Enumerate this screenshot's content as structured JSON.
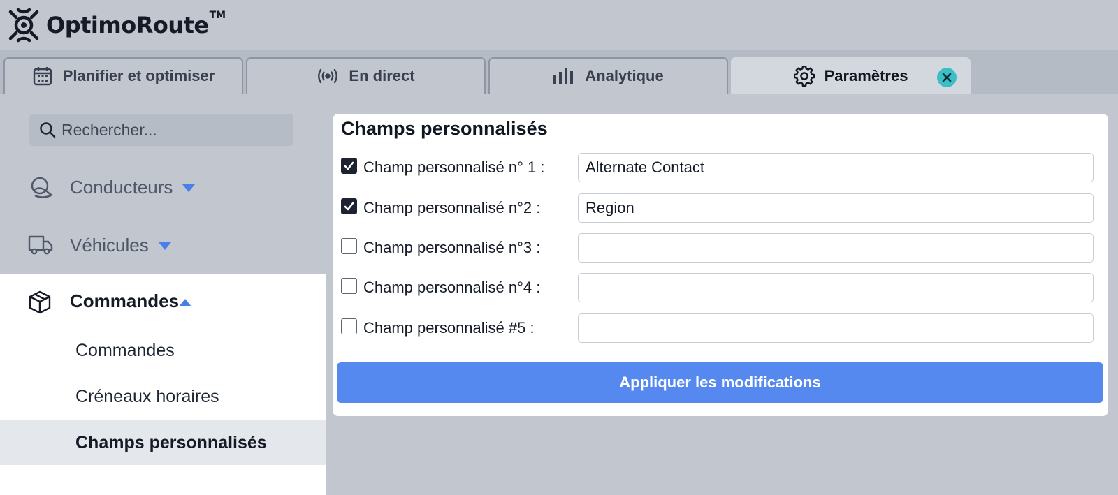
{
  "app": {
    "name": "OptimoRoute",
    "trademark": "TM"
  },
  "tabs": [
    {
      "label": "Planifier et optimiser",
      "icon": "calendar-icon",
      "active": false
    },
    {
      "label": "En direct",
      "icon": "broadcast-icon",
      "active": false
    },
    {
      "label": "Analytique",
      "icon": "bar-chart-icon",
      "active": false
    },
    {
      "label": "Paramètres",
      "icon": "gear-icon",
      "active": true
    }
  ],
  "sidebar": {
    "search_placeholder": "Rechercher...",
    "items": [
      {
        "label": "Conducteurs",
        "icon": "driver-icon",
        "expanded": false
      },
      {
        "label": "Véhicules",
        "icon": "truck-icon",
        "expanded": false
      },
      {
        "label": "Commandes",
        "icon": "package-icon",
        "expanded": true
      }
    ],
    "sub_items": [
      {
        "label": "Commandes",
        "selected": false
      },
      {
        "label": "Créneaux horaires",
        "selected": false
      },
      {
        "label": "Champs personnalisés",
        "selected": true
      }
    ]
  },
  "main": {
    "title": "Champs personnalisés",
    "fields": [
      {
        "label": "Champ personnalisé n° 1 :",
        "checked": true,
        "value": "Alternate Contact"
      },
      {
        "label": "Champ personnalisé n°2 :",
        "checked": true,
        "value": "Region"
      },
      {
        "label": "Champ personnalisé n°3 :",
        "checked": false,
        "value": ""
      },
      {
        "label": "Champ personnalisé n°4 :",
        "checked": false,
        "value": ""
      },
      {
        "label": "Champ personnalisé #5 :",
        "checked": false,
        "value": ""
      }
    ],
    "apply_label": "Appliquer les modifications"
  },
  "colors": {
    "accent": "#5689f0",
    "close_badge": "#3bbfc6",
    "caret": "#4a7ee8",
    "background": "#c1c6cf"
  }
}
